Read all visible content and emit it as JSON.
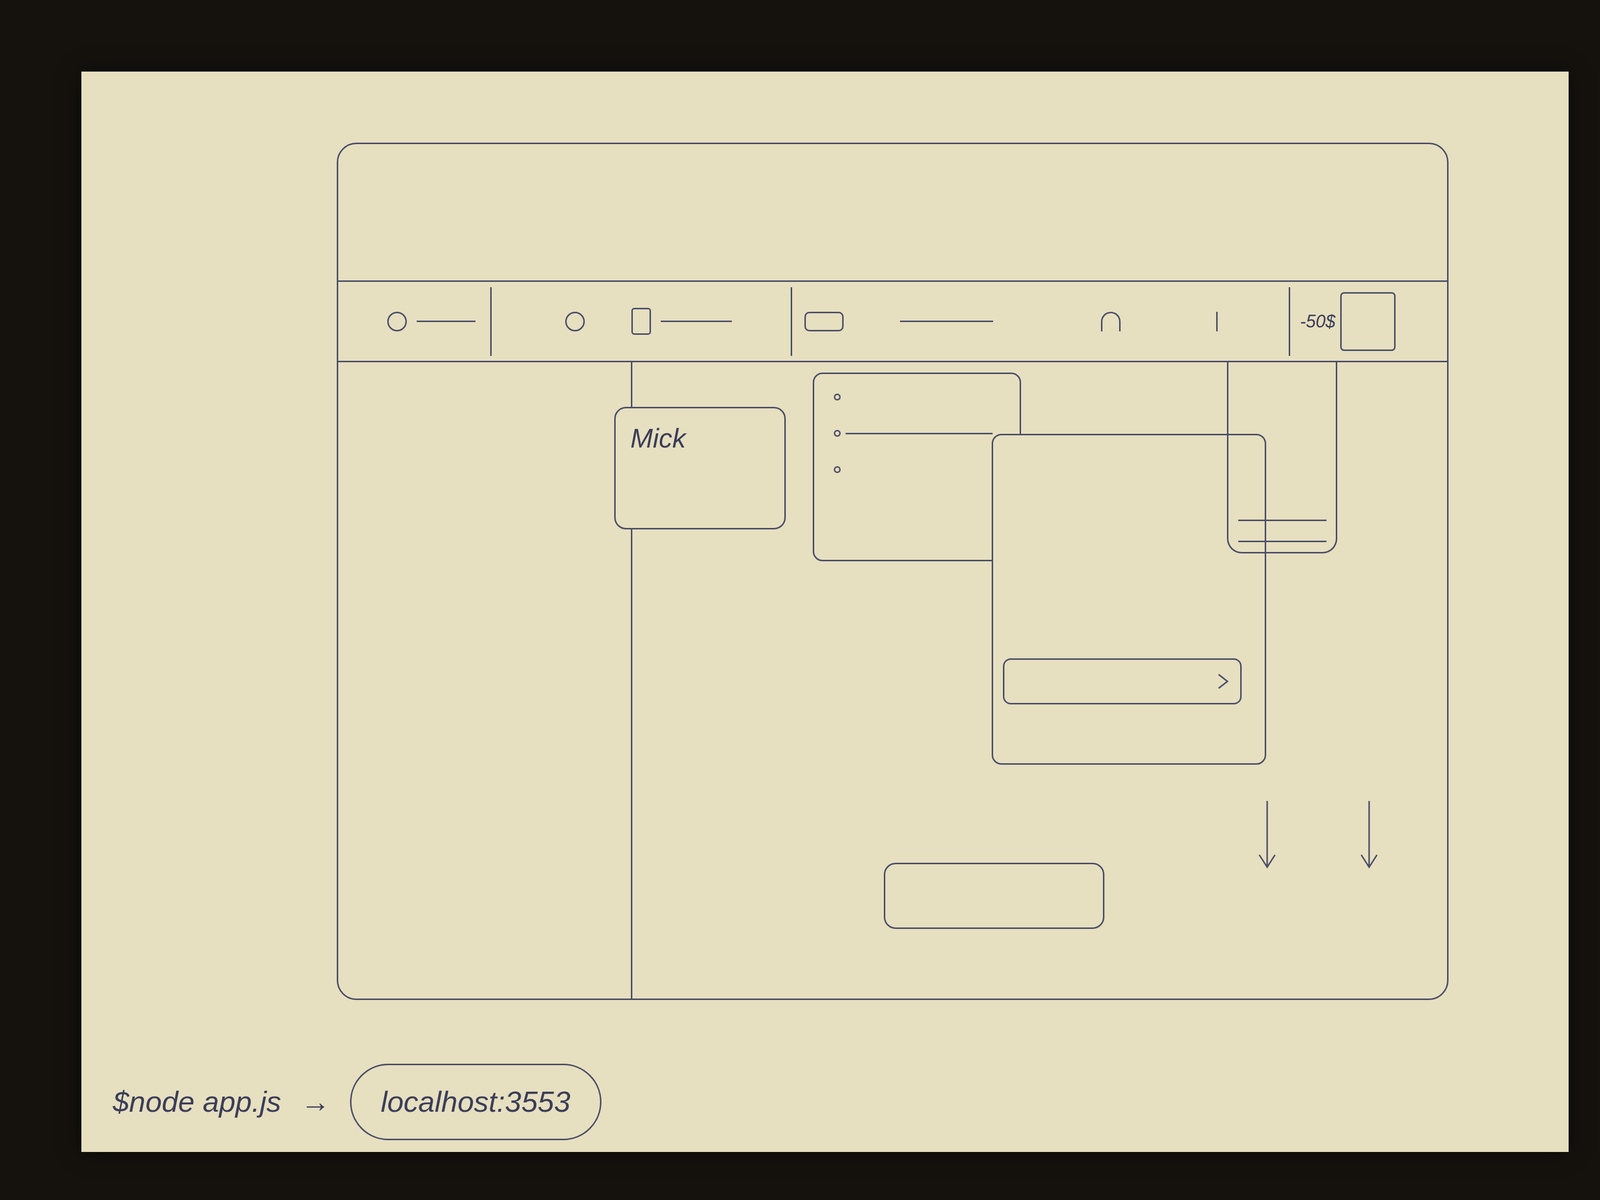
{
  "sketch": {
    "toolbar": {
      "balance": "-50$"
    },
    "popover": {
      "label": "Mick"
    }
  },
  "caption": {
    "command": "$node app.js",
    "arrow": "→",
    "url": "localhost:3553"
  }
}
